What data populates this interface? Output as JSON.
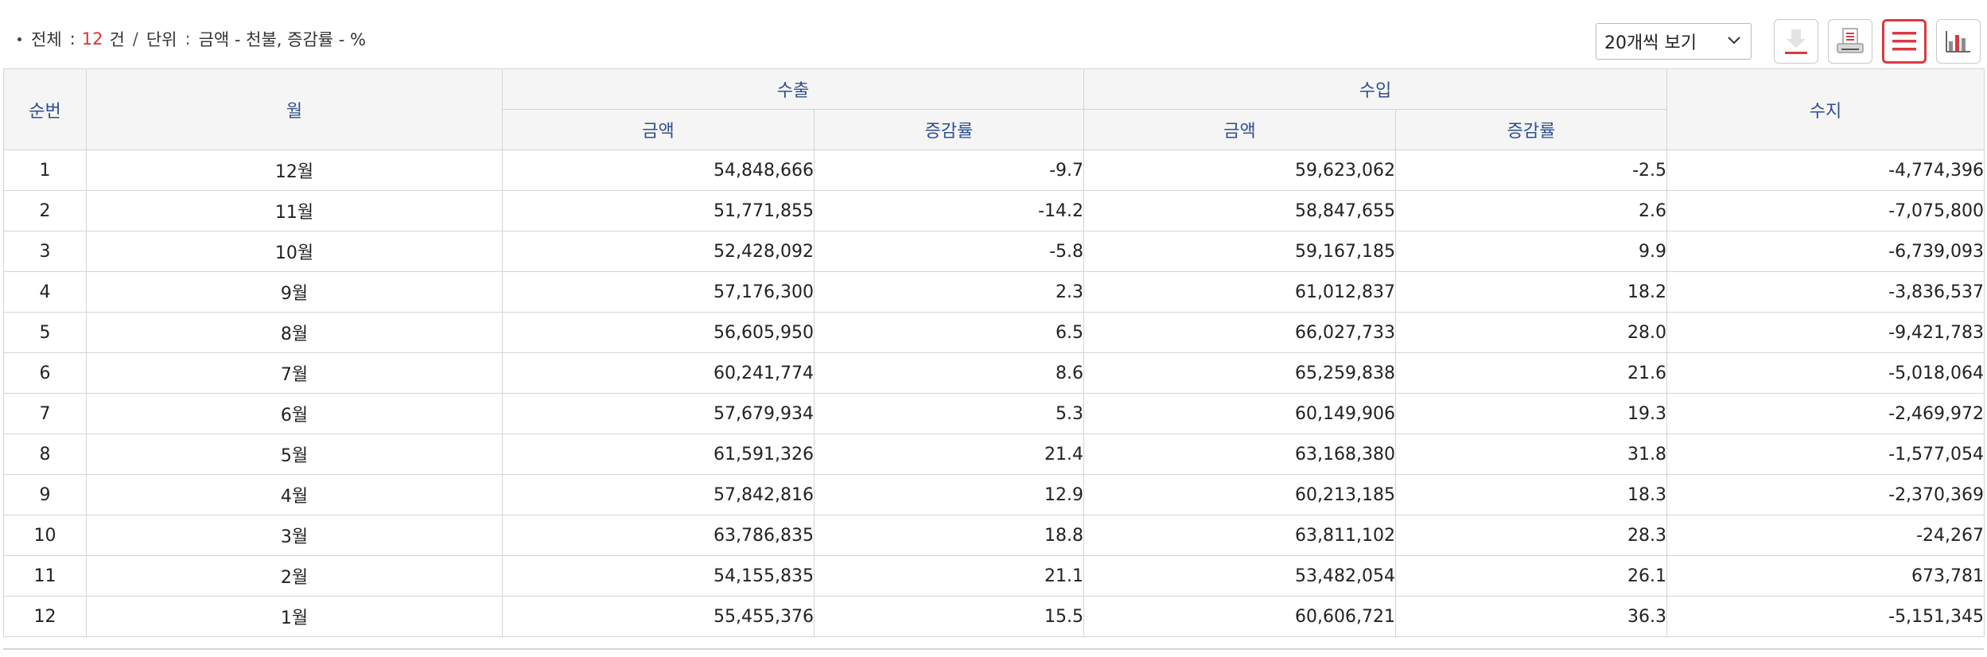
{
  "summary": {
    "total_label": "전체",
    "colon": ":",
    "count": "12",
    "count_unit": "건",
    "divider": "/",
    "unit_label": "단위",
    "unit_colon": ":",
    "unit_text": "금액 - 천불, 증감률 - %"
  },
  "toolbar": {
    "page_size_selected": "20개씩 보기",
    "buttons": [
      {
        "icon": "download-icon",
        "active": false
      },
      {
        "icon": "print-icon",
        "active": false
      },
      {
        "icon": "list-view-icon",
        "active": true
      },
      {
        "icon": "chart-view-icon",
        "active": false
      }
    ]
  },
  "accent_color": "#d83a42",
  "header_color": "#2f4f8f",
  "table": {
    "headers": {
      "seq": "순번",
      "month": "월",
      "export": "수출",
      "import": "수입",
      "balance": "수지",
      "amount": "금액",
      "rate": "증감률"
    },
    "rows": [
      {
        "seq": "1",
        "month": "12월",
        "ex_amount": "54,848,666",
        "ex_rate": "-9.7",
        "im_amount": "59,623,062",
        "im_rate": "-2.5",
        "balance": "-4,774,396"
      },
      {
        "seq": "2",
        "month": "11월",
        "ex_amount": "51,771,855",
        "ex_rate": "-14.2",
        "im_amount": "58,847,655",
        "im_rate": "2.6",
        "balance": "-7,075,800"
      },
      {
        "seq": "3",
        "month": "10월",
        "ex_amount": "52,428,092",
        "ex_rate": "-5.8",
        "im_amount": "59,167,185",
        "im_rate": "9.9",
        "balance": "-6,739,093"
      },
      {
        "seq": "4",
        "month": "9월",
        "ex_amount": "57,176,300",
        "ex_rate": "2.3",
        "im_amount": "61,012,837",
        "im_rate": "18.2",
        "balance": "-3,836,537"
      },
      {
        "seq": "5",
        "month": "8월",
        "ex_amount": "56,605,950",
        "ex_rate": "6.5",
        "im_amount": "66,027,733",
        "im_rate": "28.0",
        "balance": "-9,421,783"
      },
      {
        "seq": "6",
        "month": "7월",
        "ex_amount": "60,241,774",
        "ex_rate": "8.6",
        "im_amount": "65,259,838",
        "im_rate": "21.6",
        "balance": "-5,018,064"
      },
      {
        "seq": "7",
        "month": "6월",
        "ex_amount": "57,679,934",
        "ex_rate": "5.3",
        "im_amount": "60,149,906",
        "im_rate": "19.3",
        "balance": "-2,469,972"
      },
      {
        "seq": "8",
        "month": "5월",
        "ex_amount": "61,591,326",
        "ex_rate": "21.4",
        "im_amount": "63,168,380",
        "im_rate": "31.8",
        "balance": "-1,577,054"
      },
      {
        "seq": "9",
        "month": "4월",
        "ex_amount": "57,842,816",
        "ex_rate": "12.9",
        "im_amount": "60,213,185",
        "im_rate": "18.3",
        "balance": "-2,370,369"
      },
      {
        "seq": "10",
        "month": "3월",
        "ex_amount": "63,786,835",
        "ex_rate": "18.8",
        "im_amount": "63,811,102",
        "im_rate": "28.3",
        "balance": "-24,267"
      },
      {
        "seq": "11",
        "month": "2월",
        "ex_amount": "54,155,835",
        "ex_rate": "21.1",
        "im_amount": "53,482,054",
        "im_rate": "26.1",
        "balance": "673,781"
      },
      {
        "seq": "12",
        "month": "1월",
        "ex_amount": "55,455,376",
        "ex_rate": "15.5",
        "im_amount": "60,606,721",
        "im_rate": "36.3",
        "balance": "-5,151,345"
      }
    ]
  }
}
